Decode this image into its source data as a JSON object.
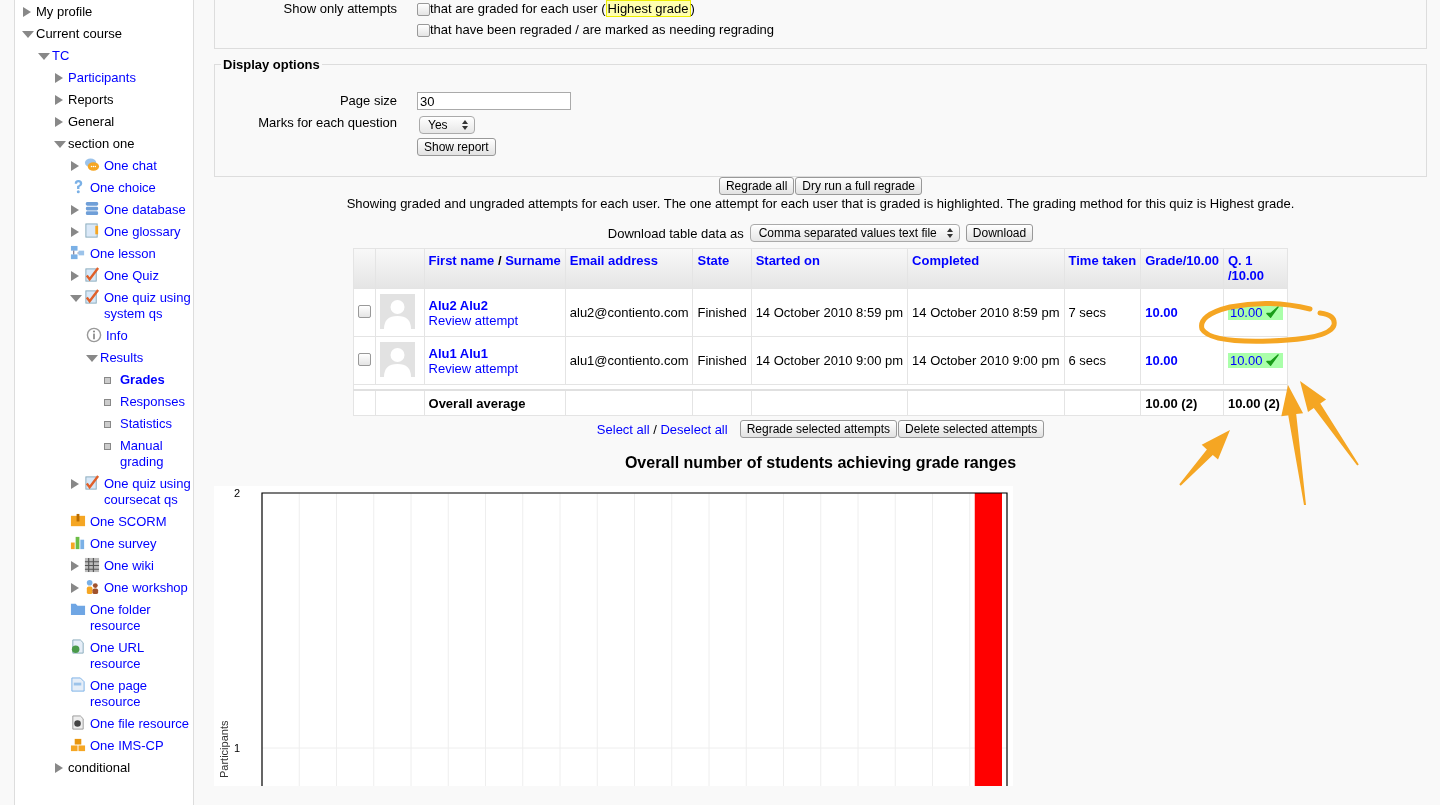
{
  "sidebar": {
    "items": [
      {
        "label": "My profile",
        "link": false,
        "expanded": false
      },
      {
        "label": "Current course",
        "link": false,
        "expanded": true,
        "children": [
          {
            "label": "TC",
            "link": true,
            "expanded": true,
            "children": [
              {
                "label": "Participants",
                "link": true,
                "expanded": false
              },
              {
                "label": "Reports",
                "link": false,
                "expanded": false
              },
              {
                "label": "General",
                "link": false,
                "expanded": false
              },
              {
                "label": "section one",
                "link": false,
                "expanded": true,
                "children": [
                  {
                    "label": "One chat",
                    "link": true,
                    "kind": "chat",
                    "expanded": false
                  },
                  {
                    "label": "One choice",
                    "link": true,
                    "kind": "choice"
                  },
                  {
                    "label": "One database",
                    "link": true,
                    "kind": "database",
                    "expanded": false
                  },
                  {
                    "label": "One glossary",
                    "link": true,
                    "kind": "glossary",
                    "expanded": false
                  },
                  {
                    "label": "One lesson",
                    "link": true,
                    "kind": "lesson"
                  },
                  {
                    "label": "One Quiz",
                    "link": true,
                    "kind": "quiz",
                    "expanded": false
                  },
                  {
                    "label": "One quiz using system qs",
                    "link": true,
                    "kind": "quiz",
                    "expanded": true,
                    "children": [
                      {
                        "label": "Info",
                        "link": true,
                        "kind": "info"
                      },
                      {
                        "label": "Results",
                        "link": true,
                        "expanded": true,
                        "children": [
                          {
                            "label": "Grades",
                            "link": true,
                            "kind": "bullet",
                            "current": true
                          },
                          {
                            "label": "Responses",
                            "link": true,
                            "kind": "bullet",
                            "current": false
                          },
                          {
                            "label": "Statistics",
                            "link": true,
                            "kind": "bullet",
                            "current": false
                          },
                          {
                            "label": "Manual grading",
                            "link": true,
                            "kind": "bullet",
                            "current": false
                          }
                        ]
                      }
                    ]
                  },
                  {
                    "label": "One quiz using coursecat qs",
                    "link": true,
                    "kind": "quiz",
                    "expanded": false
                  },
                  {
                    "label": "One SCORM",
                    "link": true,
                    "kind": "scorm"
                  },
                  {
                    "label": "One survey",
                    "link": true,
                    "kind": "survey"
                  },
                  {
                    "label": "One wiki",
                    "link": true,
                    "kind": "wiki",
                    "expanded": false
                  },
                  {
                    "label": "One workshop",
                    "link": true,
                    "kind": "workshop",
                    "expanded": false
                  },
                  {
                    "label": "One folder resource",
                    "link": true,
                    "kind": "folder"
                  },
                  {
                    "label": "One URL resource",
                    "link": true,
                    "kind": "url"
                  },
                  {
                    "label": "One page resource",
                    "link": true,
                    "kind": "page"
                  },
                  {
                    "label": "One file resource",
                    "link": true,
                    "kind": "file"
                  },
                  {
                    "label": "One IMS-CP",
                    "link": true,
                    "kind": "imscp"
                  }
                ]
              },
              {
                "label": "conditional",
                "link": false,
                "expanded": false
              }
            ]
          }
        ]
      }
    ]
  },
  "filter": {
    "label": "Show only attempts",
    "options": [
      {
        "text": "that are graded for each user (",
        "highlight": "Highest grade",
        "suffix": ")",
        "checked": false
      },
      {
        "text": "that have been regraded / are marked as needing regrading",
        "checked": false
      }
    ]
  },
  "display_options": {
    "legend": "Display options",
    "page_size": {
      "label": "Page size",
      "value": "30"
    },
    "marks": {
      "label": "Marks for each question",
      "value": "Yes"
    },
    "submit": "Show report"
  },
  "regrade_buttons": [
    "Regrade all",
    "Dry run a full regrade"
  ],
  "info": "Showing graded and ungraded attempts for each user. The one attempt for each user that is graded is highlighted. The grading method for this quiz is Highest grade.",
  "download": {
    "label": "Download table data as",
    "format": "Comma separated values text file",
    "button": "Download"
  },
  "table": {
    "columns": [
      {
        "kind": "name",
        "links": [
          "First name",
          "Surname"
        ],
        "separator": "/"
      },
      {
        "label": "Email address"
      },
      {
        "label": "State"
      },
      {
        "label": "Started on"
      },
      {
        "label": "Completed"
      },
      {
        "label": "Time taken"
      },
      {
        "label": "Grade/10.00"
      },
      {
        "label": "Q. 1 /10.00",
        "kind": "narrow"
      }
    ],
    "rows": [
      {
        "checked": false,
        "name": "Alu2 Alu2",
        "review": "Review attempt",
        "email": "alu2@contiento.com",
        "state": "Finished",
        "started": "14 October 2010 8:59 pm",
        "completed": "14 October 2010 8:59 pm",
        "time_taken": "7 secs",
        "grade": "10.00",
        "q1": {
          "value": "10.00",
          "correct": true
        }
      },
      {
        "checked": false,
        "name": "Alu1 Alu1",
        "review": "Review attempt",
        "email": "alu1@contiento.com",
        "state": "Finished",
        "started": "14 October 2010 9:00 pm",
        "completed": "14 October 2010 9:00 pm",
        "time_taken": "6 secs",
        "grade": "10.00",
        "q1": {
          "value": "10.00",
          "correct": true
        }
      }
    ],
    "average": {
      "label": "Overall average",
      "grade": "10.00 (2)",
      "q1": "10.00 (2)"
    }
  },
  "selection": {
    "select_all": "Select all",
    "separator": "/",
    "deselect_all": "Deselect all",
    "buttons": [
      "Regrade selected attempts",
      "Delete selected attempts"
    ]
  },
  "chart": {
    "chart_data": {
      "type": "bar",
      "title": "Overall number of students achieving grade ranges",
      "ylabel": "Participants",
      "ylim": [
        0,
        2
      ],
      "yticks": [
        1,
        2
      ],
      "series": [
        {
          "color": "#ff0000",
          "values": [
            null,
            null,
            null,
            null,
            null,
            null,
            null,
            null,
            null,
            null,
            null,
            null,
            null,
            null,
            null,
            null,
            null,
            null,
            null,
            2
          ]
        }
      ]
    }
  }
}
